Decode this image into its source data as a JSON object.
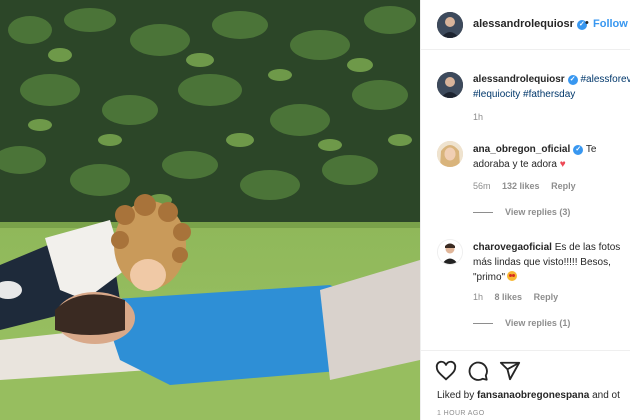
{
  "post": {
    "author": "alessandrolequiosr",
    "follow_label": "Follow",
    "separator": "•",
    "image_alt": "photo of a man lying on the grass kissed by a young child"
  },
  "caption": {
    "author": "alessandrolequiosr",
    "text_part1": "#alessforever",
    "text_part2": "#lequiocity #fathersday",
    "time": "1h"
  },
  "comments": [
    {
      "user": "ana_obregon_oficial",
      "text_line1": "Te",
      "text_line2": "adoraba y te adora",
      "time": "56m",
      "likes": "132 likes",
      "reply_label": "Reply",
      "view_replies": "View replies (3)"
    },
    {
      "user": "charovegaoficial",
      "text_line1": "Es de las fotos",
      "text_line2": "más lindas que visto!!!!! Besos,",
      "text_line3": "\"primo\"",
      "time": "1h",
      "likes": "8 likes",
      "reply_label": "Reply",
      "view_replies": "View replies (1)"
    }
  ],
  "footer": {
    "liked_by_prefix": "Liked by",
    "liked_by_user": "fansanaobregonespana",
    "liked_by_suffix": "and ot",
    "time_ago": "1 HOUR AGO"
  },
  "icons": {
    "like": "heart-icon",
    "comment": "comment-icon",
    "share": "share-icon",
    "verified": "verified-badge-icon"
  },
  "colors": {
    "accent": "#3897f0",
    "text": "#262626",
    "muted": "#8e8e8e",
    "hashtag": "#00376b",
    "heart": "#ed4956"
  }
}
